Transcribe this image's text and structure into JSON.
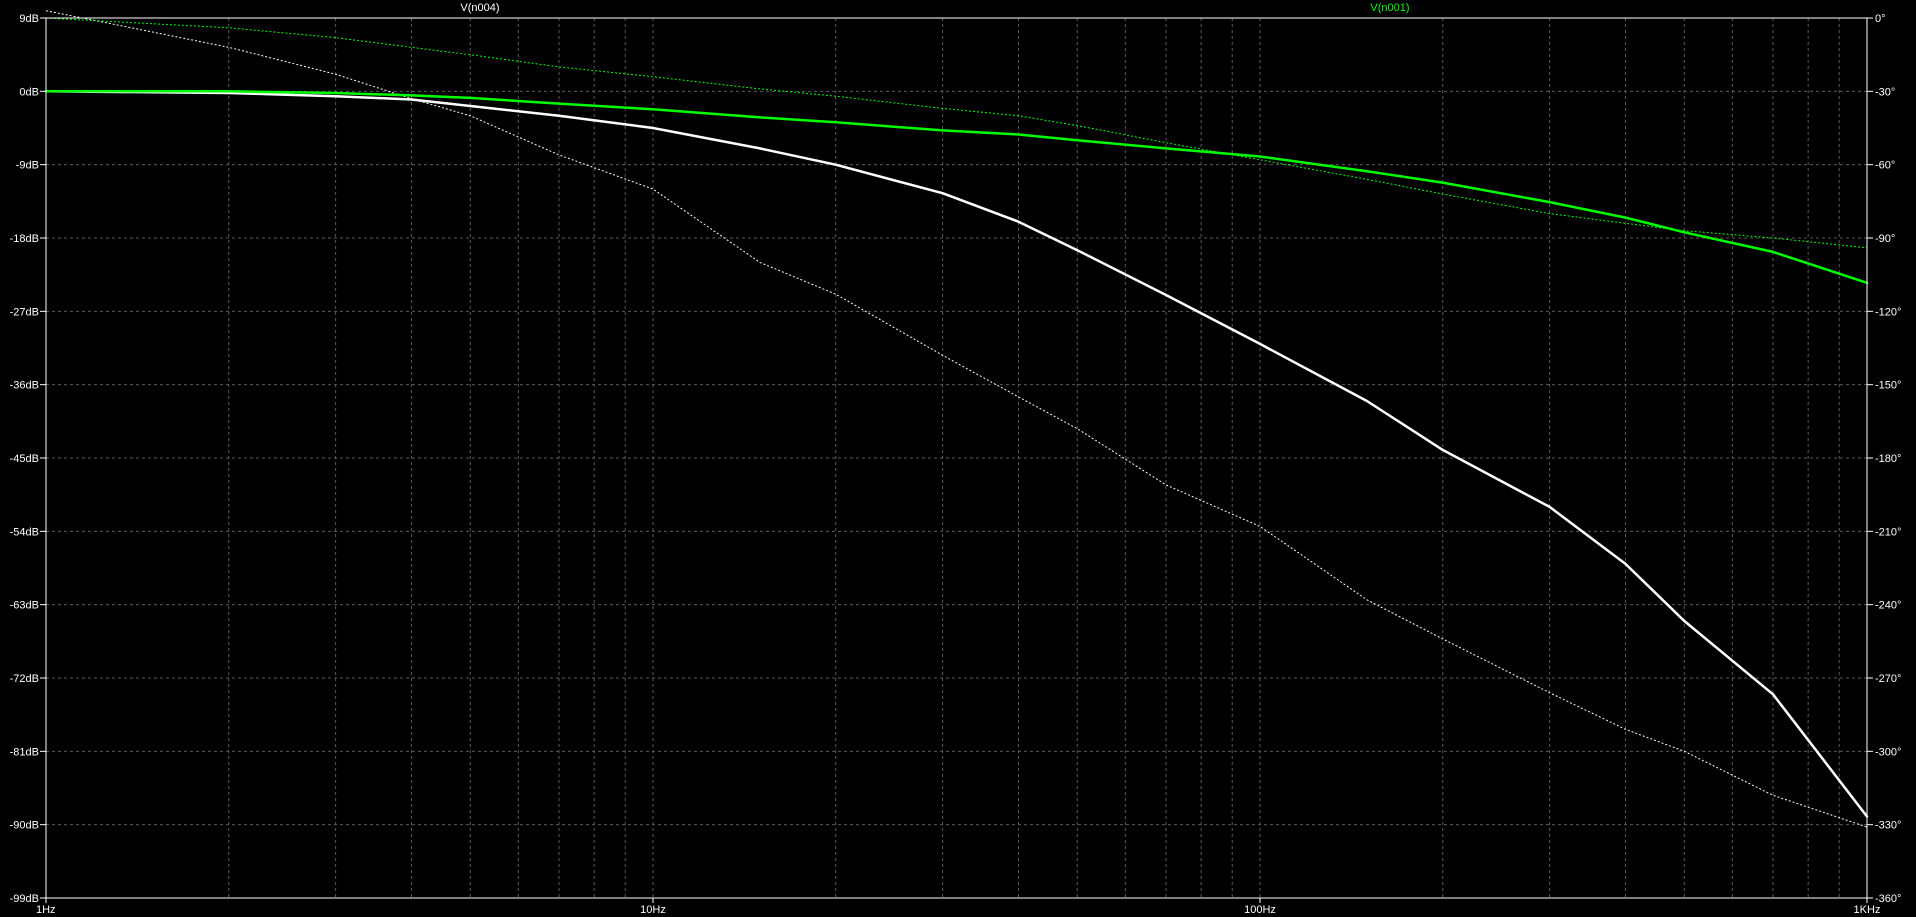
{
  "chart_data": {
    "type": "line",
    "title": "",
    "background": "#000000",
    "grid": true,
    "grid_style": "dashed",
    "grid_color": "#5a5a5a",
    "axis_color": "#ffffff",
    "x_axis": {
      "scale": "log",
      "range": [
        1,
        1000
      ],
      "tick_labels": [
        {
          "value": 1,
          "label": "1Hz"
        },
        {
          "value": 10,
          "label": "10Hz"
        },
        {
          "value": 100,
          "label": "100Hz"
        },
        {
          "value": 1000,
          "label": "1KHz"
        }
      ],
      "minor_ticks": true
    },
    "y_axis_left": {
      "unit": "dB",
      "range": [
        -99,
        9
      ],
      "ticks": [
        9,
        0,
        -9,
        -18,
        -27,
        -36,
        -45,
        -54,
        -63,
        -72,
        -81,
        -90,
        -99
      ],
      "tick_labels": [
        "9dB",
        "0dB",
        "-9dB",
        "-18dB",
        "-27dB",
        "-36dB",
        "-45dB",
        "-54dB",
        "-63dB",
        "-72dB",
        "-81dB",
        "-90dB",
        "-99dB"
      ]
    },
    "y_axis_right": {
      "unit": "degrees",
      "range": [
        -360,
        0
      ],
      "ticks": [
        0,
        -30,
        -60,
        -90,
        -120,
        -150,
        -180,
        -210,
        -240,
        -270,
        -300,
        -330,
        -360
      ],
      "tick_labels": [
        "0°",
        "-30°",
        "-60°",
        "-90°",
        "-120°",
        "-150°",
        "-180°",
        "-210°",
        "-240°",
        "-270°",
        "-300°",
        "-330°",
        "-360°"
      ]
    },
    "series": [
      {
        "name": "V(n004)",
        "color": "#ffffff",
        "magnitude_db": {
          "x": [
            1,
            2,
            3,
            4,
            5,
            7,
            10,
            15,
            20,
            30,
            40,
            50,
            70,
            100,
            150,
            200,
            300,
            400,
            500,
            700,
            1000
          ],
          "y": [
            0,
            -0.2,
            -0.6,
            -1,
            -1.8,
            -3,
            -4.5,
            -7,
            -9,
            -12.5,
            -16,
            -19.5,
            -25,
            -31,
            -38,
            -44,
            -51,
            -58,
            -65,
            -74,
            -89
          ]
        },
        "phase_deg": {
          "x": [
            1,
            2,
            3,
            4,
            5,
            7,
            10,
            15,
            20,
            30,
            40,
            50,
            70,
            100,
            150,
            200,
            300,
            400,
            500,
            700,
            1000
          ],
          "y": [
            3,
            -12,
            -23,
            -33,
            -40,
            -56,
            -70,
            -100,
            -113,
            -138,
            -155,
            -168,
            -191,
            -208,
            -238,
            -254,
            -276,
            -291,
            -300,
            -318,
            -331
          ]
        }
      },
      {
        "name": "V(n001)",
        "color": "#00ff00",
        "magnitude_db": {
          "x": [
            1,
            2,
            3,
            4,
            5,
            7,
            10,
            15,
            20,
            30,
            40,
            50,
            70,
            100,
            150,
            200,
            300,
            400,
            500,
            700,
            1000
          ],
          "y": [
            0,
            0,
            -0.2,
            -0.5,
            -0.8,
            -1.5,
            -2.2,
            -3.2,
            -3.8,
            -4.8,
            -5.3,
            -6,
            -7,
            -8,
            -9.8,
            -11.2,
            -13.6,
            -15.5,
            -17.3,
            -19.7,
            -23.5
          ]
        },
        "phase_deg": {
          "x": [
            1,
            2,
            3,
            4,
            5,
            7,
            10,
            15,
            20,
            30,
            40,
            50,
            70,
            100,
            150,
            200,
            300,
            400,
            500,
            700,
            1000
          ],
          "y": [
            0,
            -4,
            -8,
            -12,
            -15,
            -20,
            -24,
            -29,
            -32,
            -37,
            -40,
            -44,
            -51,
            -58,
            -66,
            -72,
            -80,
            -84,
            -87,
            -90,
            -94
          ]
        }
      }
    ]
  }
}
